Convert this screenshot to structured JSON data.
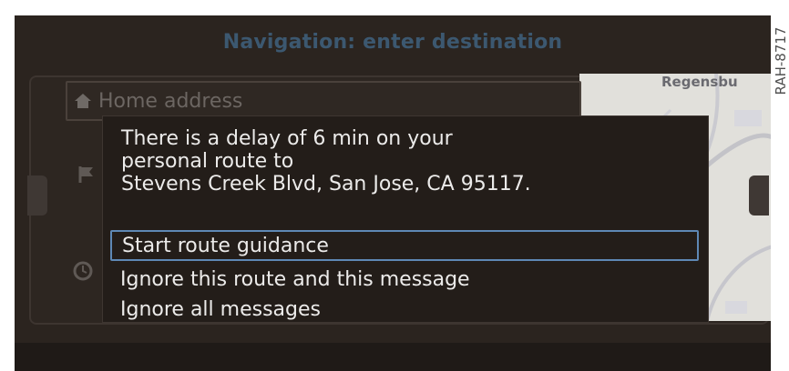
{
  "header": {
    "title": "Navigation: enter destination"
  },
  "list": {
    "home_label": "Home address"
  },
  "map": {
    "label": "Regensbu"
  },
  "popup": {
    "message_lines": [
      "There is a delay of 6 min on your",
      "personal route to",
      "Stevens Creek Blvd, San Jose, CA 95117."
    ],
    "options": [
      "Start route guidance",
      "Ignore this route and this message",
      "Ignore all messages"
    ],
    "selected_index": 0
  },
  "figure_code": "RAH-8717",
  "icons": {
    "home": "home-icon",
    "flag": "flag-icon",
    "clock": "clock-icon"
  },
  "colors": {
    "background": "#2b241f",
    "title": "#3c5870",
    "selection": "#5e88b5",
    "text": "#ecebea"
  }
}
